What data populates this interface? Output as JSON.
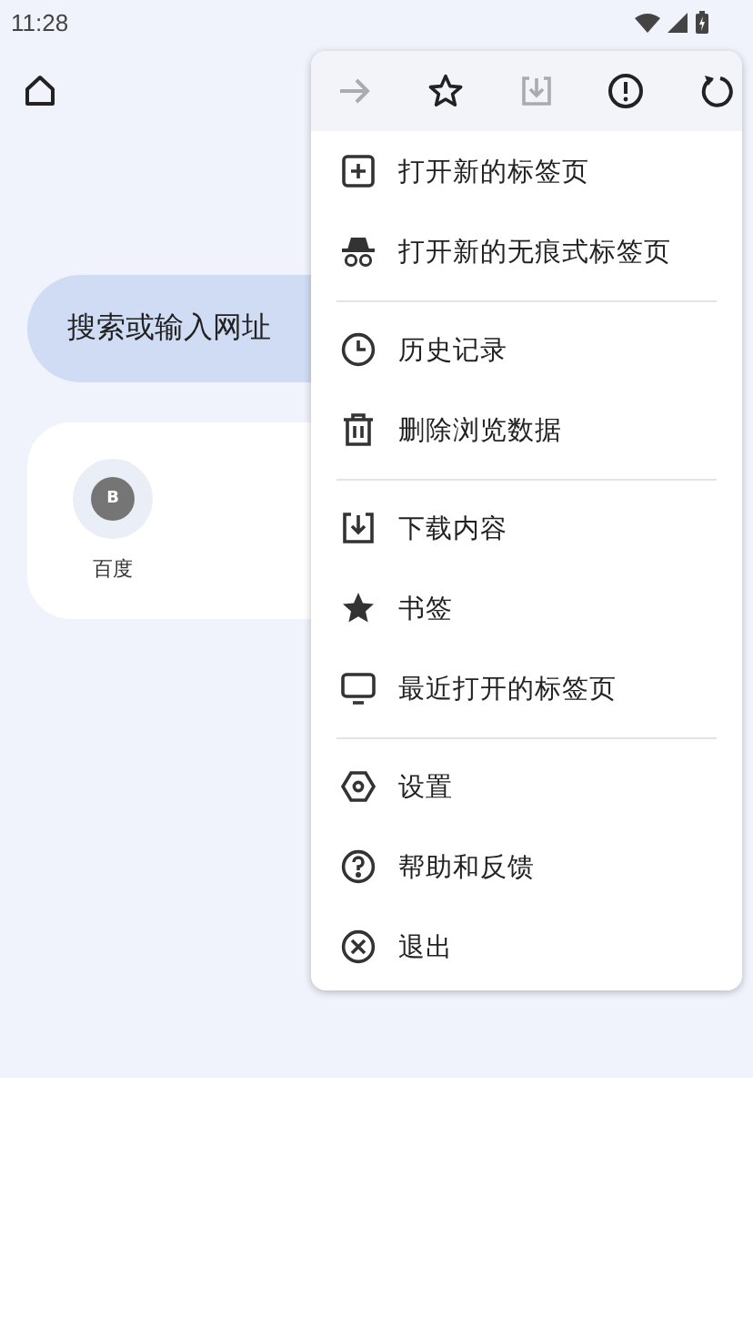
{
  "status_bar": {
    "time": "11:28"
  },
  "search": {
    "placeholder": "搜索或输入网址"
  },
  "shortcuts": [
    {
      "letter": "B",
      "label": "百度"
    }
  ],
  "menu": {
    "toolbar": [
      {
        "disabled": true
      },
      {
        "disabled": false
      },
      {
        "disabled": true
      },
      {
        "disabled": false
      },
      {
        "disabled": false
      }
    ],
    "sections": [
      [
        {
          "label": "打开新的标签页"
        },
        {
          "label": "打开新的无痕式标签页"
        }
      ],
      [
        {
          "label": "历史记录"
        },
        {
          "label": "删除浏览数据"
        }
      ],
      [
        {
          "label": "下载内容"
        },
        {
          "label": "书签"
        },
        {
          "label": "最近打开的标签页"
        }
      ],
      [
        {
          "label": "设置"
        },
        {
          "label": "帮助和反馈"
        },
        {
          "label": "退出"
        }
      ]
    ]
  }
}
